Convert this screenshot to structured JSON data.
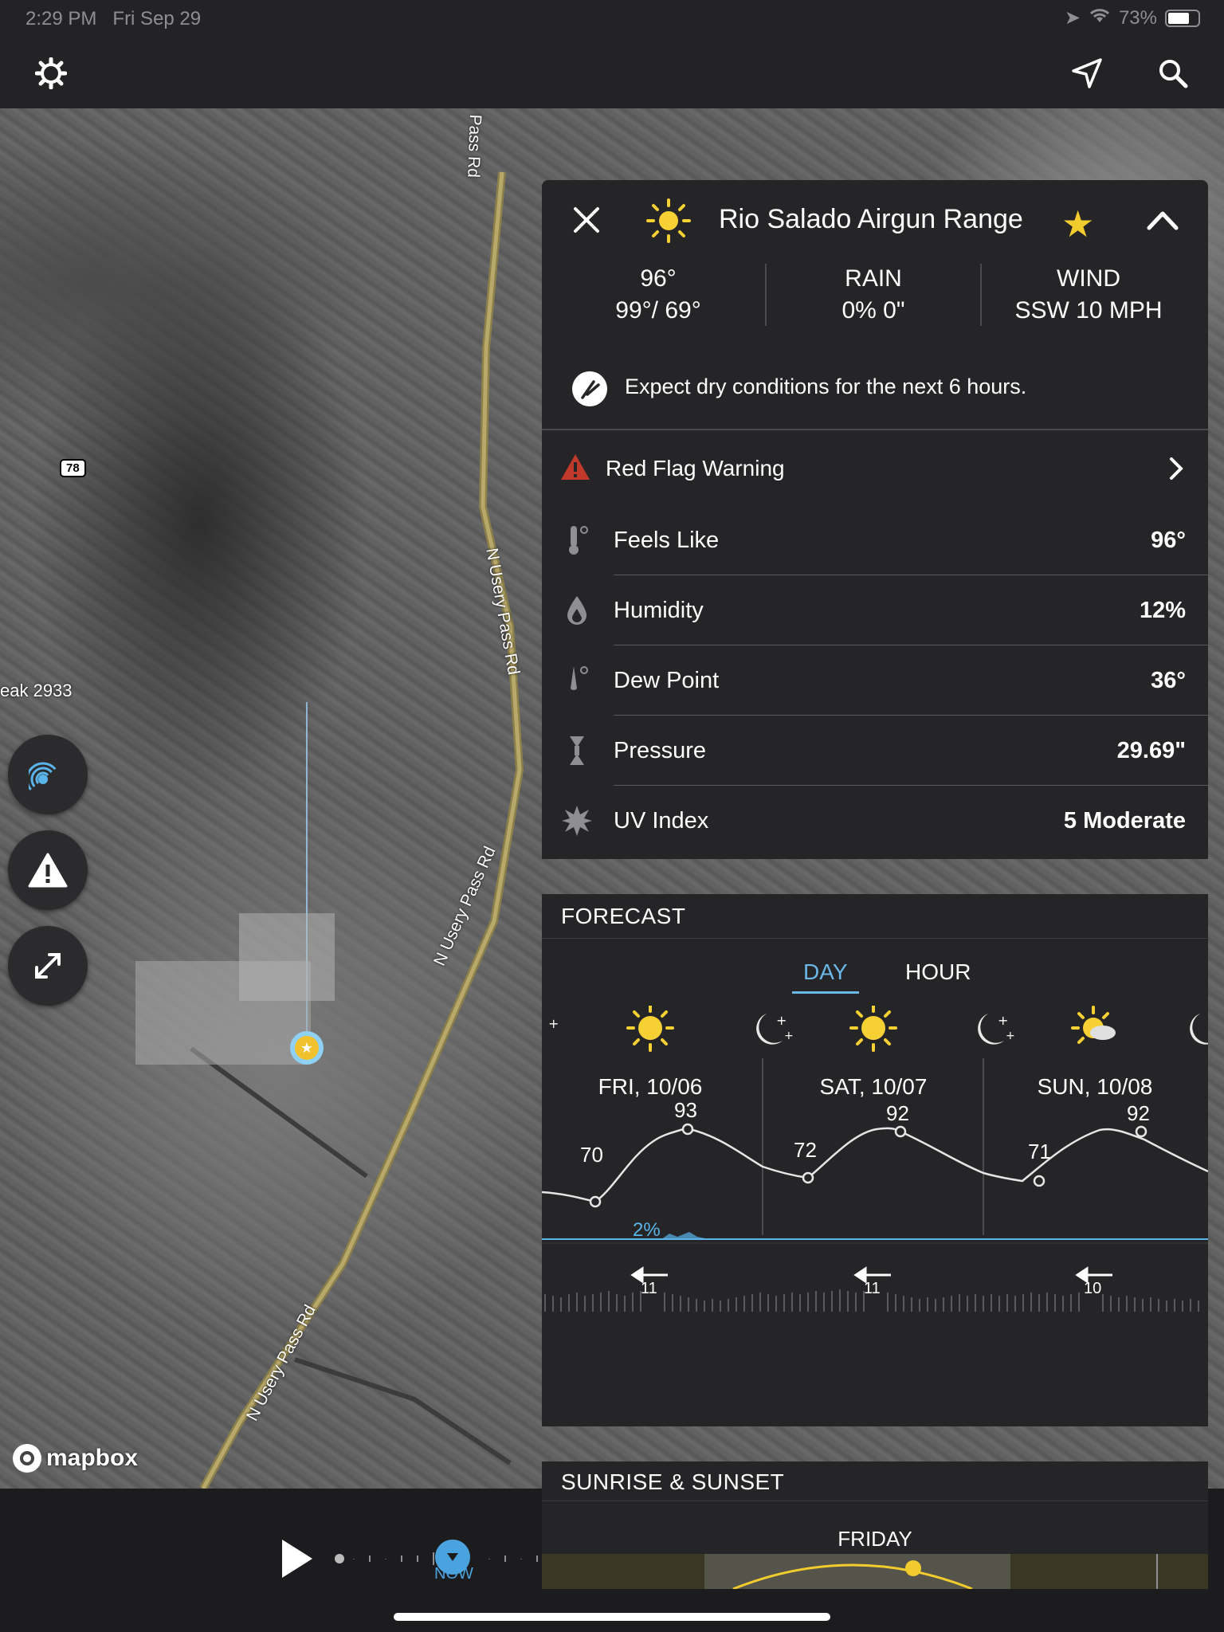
{
  "status_bar": {
    "time": "2:29 PM",
    "date": "Fri Sep 29",
    "battery": "73%",
    "battery_level": 0.73
  },
  "toolbar": {
    "settings_icon": "gear-icon",
    "locate_icon": "location-arrow-icon",
    "search_icon": "search-icon"
  },
  "map": {
    "road_labels": [
      "Pass Rd",
      "N Usery Pass Rd",
      "N Usery Pass Rd",
      "N Usery Pass Rd"
    ],
    "route_sign": "78",
    "peak_label": "eak 2933",
    "attribution": "mapbox"
  },
  "side_buttons": [
    {
      "name": "radar-layer-button",
      "icon": "radar-icon"
    },
    {
      "name": "alerts-layer-button",
      "icon": "warning-icon"
    },
    {
      "name": "expand-button",
      "icon": "expand-icon"
    }
  ],
  "panel": {
    "location": "Rio Salado Airgun Range",
    "current_temp": "96°",
    "hi_lo": "99°/ 69°",
    "rain_label": "RAIN",
    "rain_value": "0% 0\"",
    "wind_label": "WIND",
    "wind_value": "SSW 10 MPH",
    "precip_message": "Expect dry conditions for the next 6 hours.",
    "alert": "Red Flag Warning",
    "details": [
      {
        "label": "Feels Like",
        "value": "96°",
        "icon": "thermometer-icon"
      },
      {
        "label": "Humidity",
        "value": "12%",
        "icon": "humidity-drop-icon"
      },
      {
        "label": "Dew Point",
        "value": "36°",
        "icon": "dew-point-icon"
      },
      {
        "label": "Pressure",
        "value": "29.69\"",
        "icon": "pressure-icon"
      },
      {
        "label": "UV Index",
        "value": "5 Moderate",
        "icon": "uv-sun-icon"
      }
    ]
  },
  "forecast": {
    "heading": "FORECAST",
    "tabs": [
      "DAY",
      "HOUR"
    ],
    "active_tab": "DAY",
    "days": [
      {
        "label": "FRI, 10/06",
        "low": "70",
        "high": "93",
        "wind": "11",
        "icon": "sun-icon"
      },
      {
        "label": "SAT, 10/07",
        "low": "72",
        "high": "92",
        "wind": "11",
        "icon": "sun-icon"
      },
      {
        "label": "SUN, 10/08",
        "low": "71",
        "high": "92",
        "wind": "10",
        "icon": "partly-cloudy-icon"
      }
    ],
    "precip_label": "2%"
  },
  "sunrise": {
    "heading": "SUNRISE & SUNSET",
    "day": "FRIDAY"
  },
  "playback": {
    "now_label": "NOW"
  }
}
